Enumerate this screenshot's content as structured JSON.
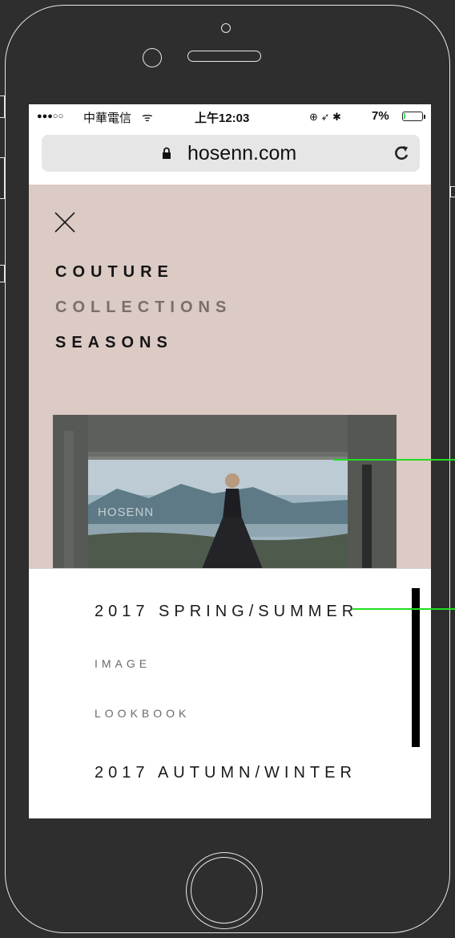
{
  "status_bar": {
    "signal": "●●●○○",
    "carrier": "中華電信",
    "wifi": "ᯤ",
    "time": "上午12:03",
    "indicators": "⊕ ➶ ✱",
    "battery": "7%",
    "battery_level": 0.07
  },
  "browser": {
    "url": "hosenn.com"
  },
  "menu": {
    "items": [
      {
        "label": "COUTURE",
        "active": true
      },
      {
        "label": "COLLECTIONS",
        "active": false
      },
      {
        "label": "SEASONS",
        "active": true
      }
    ]
  },
  "hero": {
    "logo_text": "HOSENN"
  },
  "seasons": [
    {
      "label": "2017 SPRING/SUMMER",
      "items": [
        "IMAGE",
        "LOOKBOOK"
      ]
    },
    {
      "label": "2017 AUTUMN/WINTER",
      "items": []
    }
  ],
  "colors": {
    "menu_background": "#dccac4",
    "phone_background": "#2e2e2e",
    "guide_line": "#22dd22"
  },
  "icons": [
    "lock-icon",
    "reload-icon",
    "close-icon",
    "home-button-icon"
  ]
}
